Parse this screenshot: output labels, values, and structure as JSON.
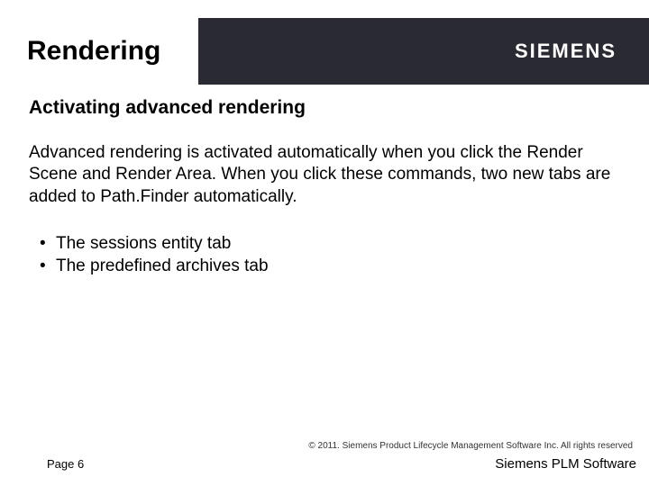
{
  "header": {
    "title": "Rendering",
    "brand": "SIEMENS"
  },
  "content": {
    "subtitle": "Activating advanced rendering",
    "body": "Advanced rendering is activated automatically when you click the Render Scene and Render Area. When you click these commands, two new tabs are added to Path.Finder automatically.",
    "bullets": [
      "The sessions entity tab",
      "The predefined archives tab"
    ]
  },
  "footer": {
    "copyright": "© 2011. Siemens Product Lifecycle Management Software Inc. All rights reserved",
    "page": "Page 6",
    "product": "Siemens PLM Software"
  }
}
